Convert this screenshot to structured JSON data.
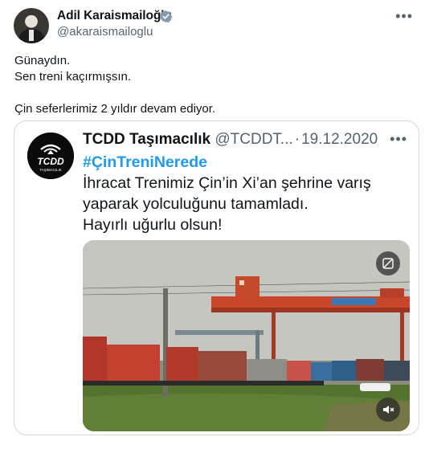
{
  "author": {
    "name": "Adil Karaismailoğlu",
    "handle": "@akaraismailoglu"
  },
  "tweet": {
    "line1": "Günaydın.",
    "line2": "Sen treni kaçırmışsın.",
    "line3": "Çin seferlerimiz 2 yıldır devam ediyor."
  },
  "quoted": {
    "name": "TCDD Taşımacılık",
    "handle": "@TCDDT...",
    "separator": "·",
    "date": "19.12.2020",
    "hashtag": "#ÇinTreniNerede",
    "body_line1": "İhracat Trenimiz Çin’in Xi’an şehrine varış",
    "body_line2": "yaparak yolculuğunu tamamladı.",
    "body_line3": "Hayırlı uğurlu olsun!",
    "logo_text": "TCDD",
    "logo_subtext": "TAŞIMACILIK"
  },
  "icons": {
    "more": "more-horizontal-icon",
    "verified": "verified-badge-icon",
    "media_top": "gif-settings-icon",
    "media_bottom": "mute-icon"
  },
  "colors": {
    "accent": "#1d9bf0",
    "text": "#0f1419",
    "muted": "#536471",
    "border": "#cfd9de"
  }
}
